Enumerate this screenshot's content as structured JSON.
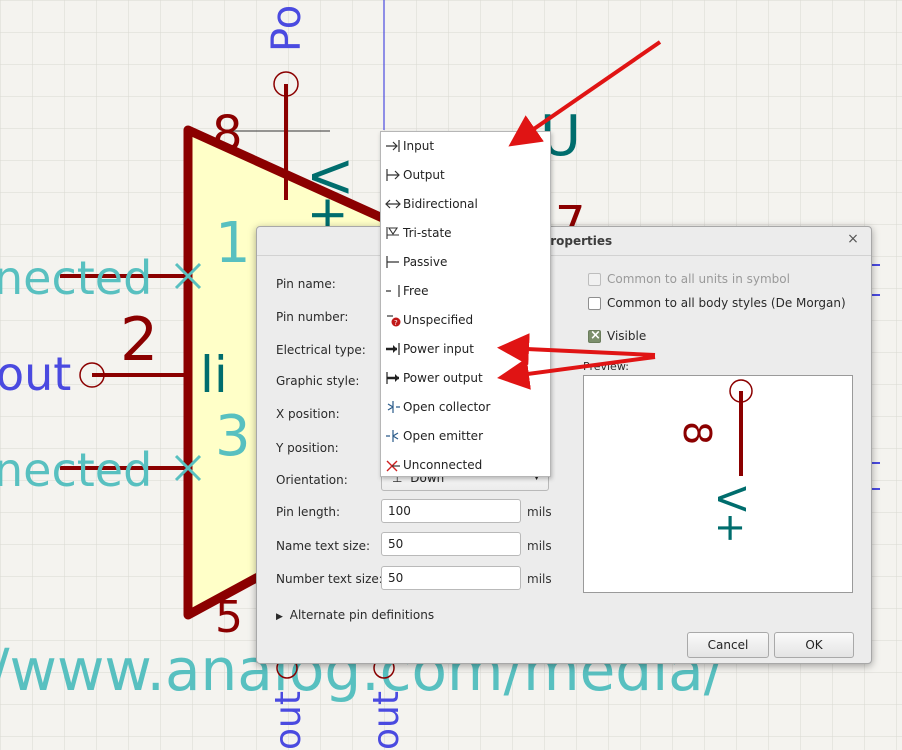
{
  "schematic": {
    "texts": {
      "top_label": "Po",
      "pin8_number": "8",
      "pin8_name": "V+",
      "pin1_number": "1",
      "pin2_number": "2",
      "pin3_number": "3",
      "pin5_number": "5",
      "pin7_number": "7",
      "left_label_1": "nected",
      "left_label_2": "out",
      "left_label_3": "nected",
      "body_text": "li",
      "bottom_url": "/www.analog.com/media/",
      "bottom_pin_left": "out",
      "bottom_pin_right": "out"
    },
    "colors": {
      "pin": "#8b0000",
      "pin_name": "#006d6d",
      "body_fill": "#ffffc8",
      "net_label": "#4a4ae0",
      "text_teal": "#58c0c0",
      "grid": "#d9d8d2",
      "arrow": "#e01414"
    }
  },
  "dialog": {
    "title": "Pin Properties",
    "close_icon": "close-icon",
    "labels": {
      "pin_name": "Pin name:",
      "pin_number": "Pin number:",
      "electrical_type": "Electrical type:",
      "graphic_style": "Graphic style:",
      "x_position": "X position:",
      "y_position": "Y position:",
      "orientation": "Orientation:",
      "pin_length": "Pin length:",
      "name_text_size": "Name text size:",
      "number_text_size": "Number text size:"
    },
    "orientation_value": "Down",
    "pin_length_value": "100",
    "name_text_size_value": "50",
    "number_text_size_value": "50",
    "unit": "mils",
    "common_units": "Common to all units in symbol",
    "common_body_styles": "Common to all body styles (De Morgan)",
    "visible": "Visible",
    "preview_label": "Preview:",
    "preview_number": "8",
    "preview_name": "V+",
    "alternate_pin_definitions": "Alternate pin definitions",
    "cancel": "Cancel",
    "ok": "OK"
  },
  "electrical_type_menu": {
    "items": [
      {
        "label": "Input",
        "icon": "input-pin-icon"
      },
      {
        "label": "Output",
        "icon": "output-pin-icon"
      },
      {
        "label": "Bidirectional",
        "icon": "bidirectional-pin-icon"
      },
      {
        "label": "Tri-state",
        "icon": "tristate-pin-icon"
      },
      {
        "label": "Passive",
        "icon": "passive-pin-icon"
      },
      {
        "label": "Free",
        "icon": "free-pin-icon"
      },
      {
        "label": "Unspecified",
        "icon": "unspecified-pin-icon"
      },
      {
        "label": "Power input",
        "icon": "power-input-pin-icon"
      },
      {
        "label": "Power output",
        "icon": "power-output-pin-icon"
      },
      {
        "label": "Open collector",
        "icon": "open-collector-pin-icon"
      },
      {
        "label": "Open emitter",
        "icon": "open-emitter-pin-icon"
      },
      {
        "label": "Unconnected",
        "icon": "unconnected-pin-icon"
      }
    ]
  }
}
